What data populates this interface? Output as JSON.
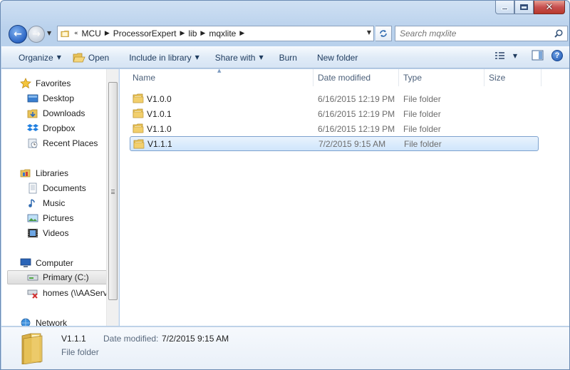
{
  "breadcrumb": {
    "overflow": "«",
    "items": [
      "MCU",
      "ProcessorExpert",
      "lib",
      "mqxlite"
    ]
  },
  "search": {
    "placeholder": "Search mqxlite"
  },
  "toolbar": {
    "organize": "Organize",
    "open": "Open",
    "include_in_library": "Include in library",
    "share_with": "Share with",
    "burn": "Burn",
    "new_folder": "New folder"
  },
  "navigation": {
    "favorites": {
      "label": "Favorites",
      "items": [
        "Desktop",
        "Downloads",
        "Dropbox",
        "Recent Places"
      ]
    },
    "libraries": {
      "label": "Libraries",
      "items": [
        "Documents",
        "Music",
        "Pictures",
        "Videos"
      ]
    },
    "computer": {
      "label": "Computer",
      "items": [
        "Primary (C:)",
        "homes (\\\\AAServ"
      ]
    },
    "network": {
      "label": "Network"
    }
  },
  "columns": {
    "name": "Name",
    "date_modified": "Date modified",
    "type": "Type",
    "size": "Size"
  },
  "files": [
    {
      "name": "V1.0.0",
      "date": "6/16/2015 12:19 PM",
      "type": "File folder"
    },
    {
      "name": "V1.0.1",
      "date": "6/16/2015 12:19 PM",
      "type": "File folder"
    },
    {
      "name": "V1.1.0",
      "date": "6/16/2015 12:19 PM",
      "type": "File folder"
    },
    {
      "name": "V1.1.1",
      "date": "7/2/2015 9:15 AM",
      "type": "File folder"
    }
  ],
  "details": {
    "name": "V1.1.1",
    "date_label": "Date modified:",
    "date_value": "7/2/2015 9:15 AM",
    "type": "File folder"
  },
  "colors": {
    "accent": "#2d66c4",
    "selection": "#cfe5fb",
    "folder": "#e8c35a"
  }
}
